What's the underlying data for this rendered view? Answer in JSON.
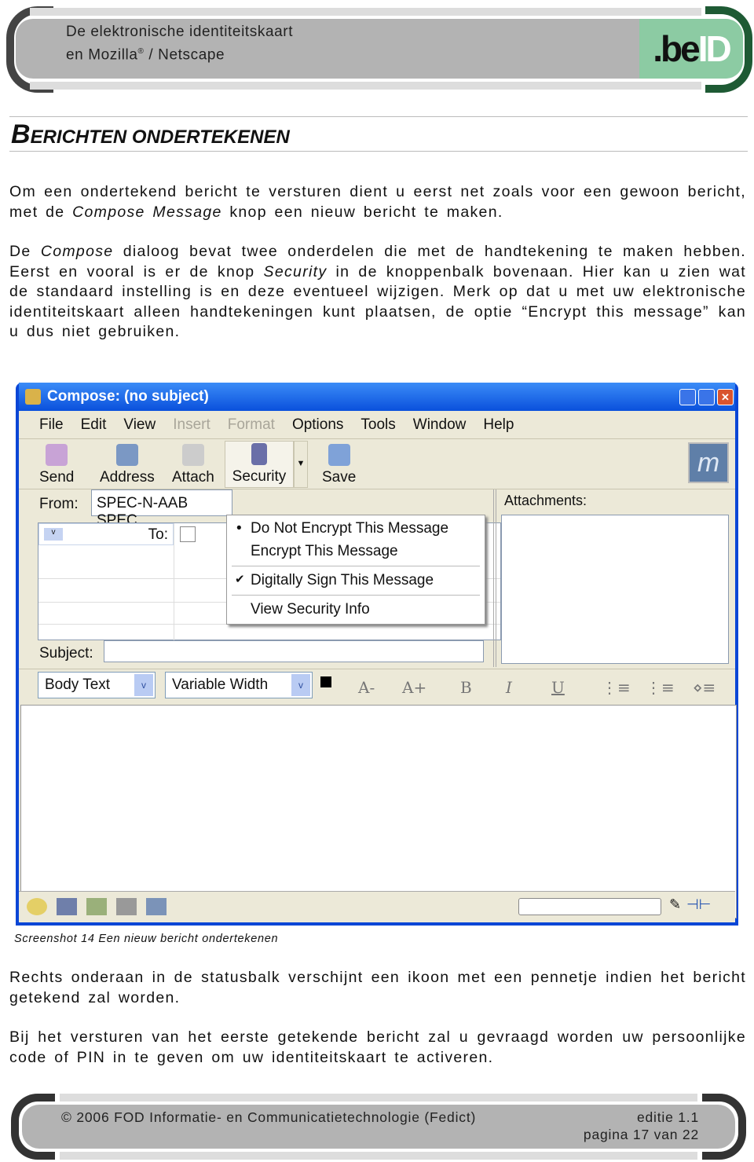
{
  "header": {
    "line1": "De elektronische identiteitskaart",
    "line2a": "en Mozilla",
    "reg": "®",
    "line2b": " / Netscape",
    "logo": ".beID"
  },
  "section_title": {
    "first": "B",
    "rest": "ERICHTEN ONDERTEKENEN"
  },
  "paragraphs": {
    "p1": [
      "Om een ondertekend bericht te versturen dient u eerst net zoals voor een gewoon bericht, met de ",
      "Compose Message",
      " knop een nieuw bericht te maken."
    ],
    "p2": [
      "De ",
      "Compose",
      " dialoog bevat twee onderdelen die met de handtekening te maken hebben. Eerst en vooral is er de knop ",
      "Security",
      " in de knoppenbalk bovenaan. Hier kan u zien wat de standaard instelling is en deze eventueel wijzigen. Merk op dat u met uw elektronische identiteitskaart alleen handtekeningen kunt plaatsen, de optie “Encrypt this message” kan u dus niet gebruiken."
    ],
    "p3": "Rechts onderaan in de statusbalk verschijnt een ikoon met een pennetje indien het bericht getekend zal worden.",
    "p4": "Bij het versturen van het eerste getekende bericht zal u gevraagd worden uw persoonlijke code of PIN in te geven om uw identiteitskaart te activeren."
  },
  "screenshot": {
    "title": "Compose: (no subject)",
    "menu": [
      "File",
      "Edit",
      "View",
      "Insert",
      "Format",
      "Options",
      "Tools",
      "Window",
      "Help"
    ],
    "toolbar": [
      "Send",
      "Address",
      "Attach",
      "Security",
      "Save"
    ],
    "from_label": "From:",
    "from_value": "SPEC-N-AAB SPEC",
    "to_label": "To:",
    "subject_label": "Subject:",
    "attachments_label": "Attachments:",
    "security_menu": [
      "Do Not Encrypt This Message",
      "Encrypt This Message",
      "Digitally Sign This Message",
      "View Security Info"
    ],
    "paragraph_style": "Body Text",
    "font": "Variable Width",
    "format_buttons": [
      "A-",
      "A+",
      "B",
      "I",
      "U"
    ],
    "colors": {
      "title_bar": "#0a46d6",
      "chrome": "#ece9d8"
    }
  },
  "caption": "Screenshot 14 Een nieuw bericht  ondertekenen",
  "footer": {
    "copyright": "© 2006  FOD Informatie- en Communicatietechnologie (Fedict)",
    "edition": "editie 1.1",
    "page": "pagina 17 van 22"
  }
}
